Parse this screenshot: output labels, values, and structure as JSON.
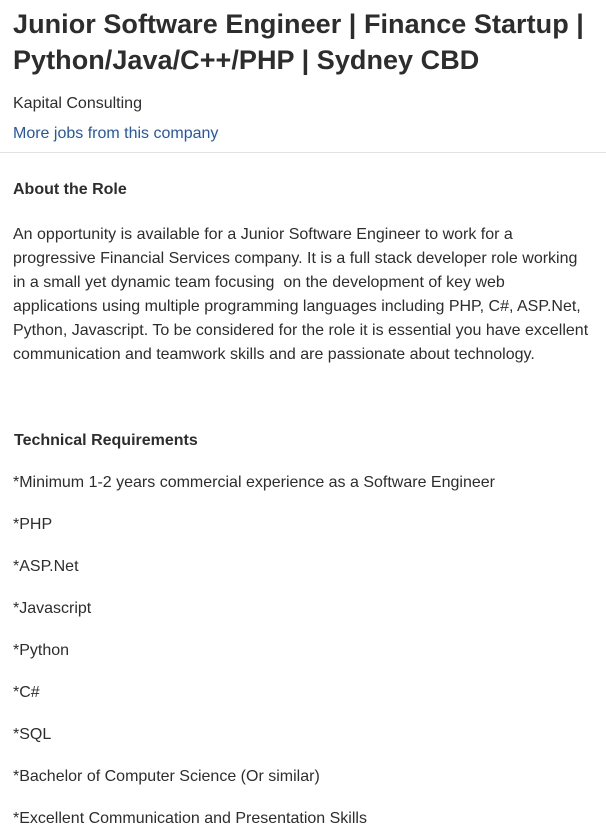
{
  "job": {
    "title": "Junior Software Engineer | Finance Startup | Python/Java/C++/PHP | Sydney CBD",
    "company": "Kapital Consulting",
    "more_jobs_link": "More jobs from this company"
  },
  "about": {
    "heading": "About the Role",
    "text": "An opportunity is available for a Junior Software Engineer to work for a progressive Financial Services company. It is a full stack developer role working in a small yet dynamic team focusing  on the development of key web applications using multiple programming languages including PHP, C#, ASP.Net, Python, Javascript. To be considered for the role it is essential you have excellent communication and teamwork skills and are passionate about technology."
  },
  "technical": {
    "heading": "Technical Requirements",
    "items": [
      "*Minimum 1-2 years commercial experience as a Software Engineer",
      "*PHP",
      "*ASP.Net",
      "*Javascript",
      "*Python",
      "*C#",
      "*SQL",
      "*Bachelor of Computer Science (Or similar)",
      "*Excellent Communication and Presentation Skills"
    ]
  },
  "colors": {
    "text": "#2d2d2d",
    "link": "#2557a7",
    "divider": "#e4e2e0"
  }
}
